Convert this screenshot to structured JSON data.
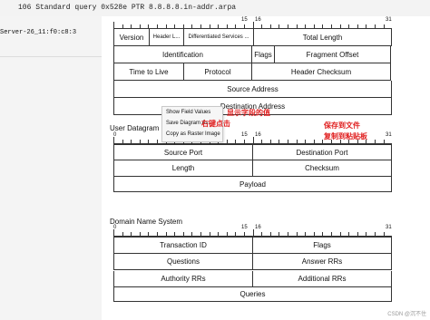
{
  "packet_line": "106 Standard query 0x528e PTR 8.8.8.8.in-addr.arpa",
  "left_item": "Server-26_11:f0:c8:3",
  "ip": {
    "rows": [
      [
        "Version",
        "Header L...",
        "Differentiated Services ...",
        "Total Length"
      ],
      [
        "Identification",
        "Flags",
        "Fragment Offset"
      ],
      [
        "Time to Live",
        "Protocol",
        "Header Checksum"
      ],
      [
        "Source Address"
      ],
      [
        "Destination Address"
      ]
    ]
  },
  "udp": {
    "title": "User Datagram Protocol",
    "rows": [
      [
        "Source Port",
        "Destination Port"
      ],
      [
        "Length",
        "Checksum"
      ],
      [
        "Payload"
      ]
    ]
  },
  "dns": {
    "title": "Domain Name System",
    "rows": [
      [
        "Transaction ID",
        "Flags"
      ],
      [
        "Questions",
        "Answer RRs"
      ],
      [
        "Authority RRs",
        "Additional RRs"
      ],
      [
        "Queries"
      ]
    ]
  },
  "ruler": {
    "n0": "0",
    "n15": "15",
    "n16": "16",
    "n31": "31"
  },
  "context_menu": [
    "Show Field Values",
    "Save Diagram As...",
    "Copy as Raster Image"
  ],
  "annotations": {
    "right_click": "右键点击",
    "show": "显示字段的值",
    "save": "保存到文件",
    "copy": "复制到粘贴板"
  },
  "watermark": "CSDN @沉不住"
}
